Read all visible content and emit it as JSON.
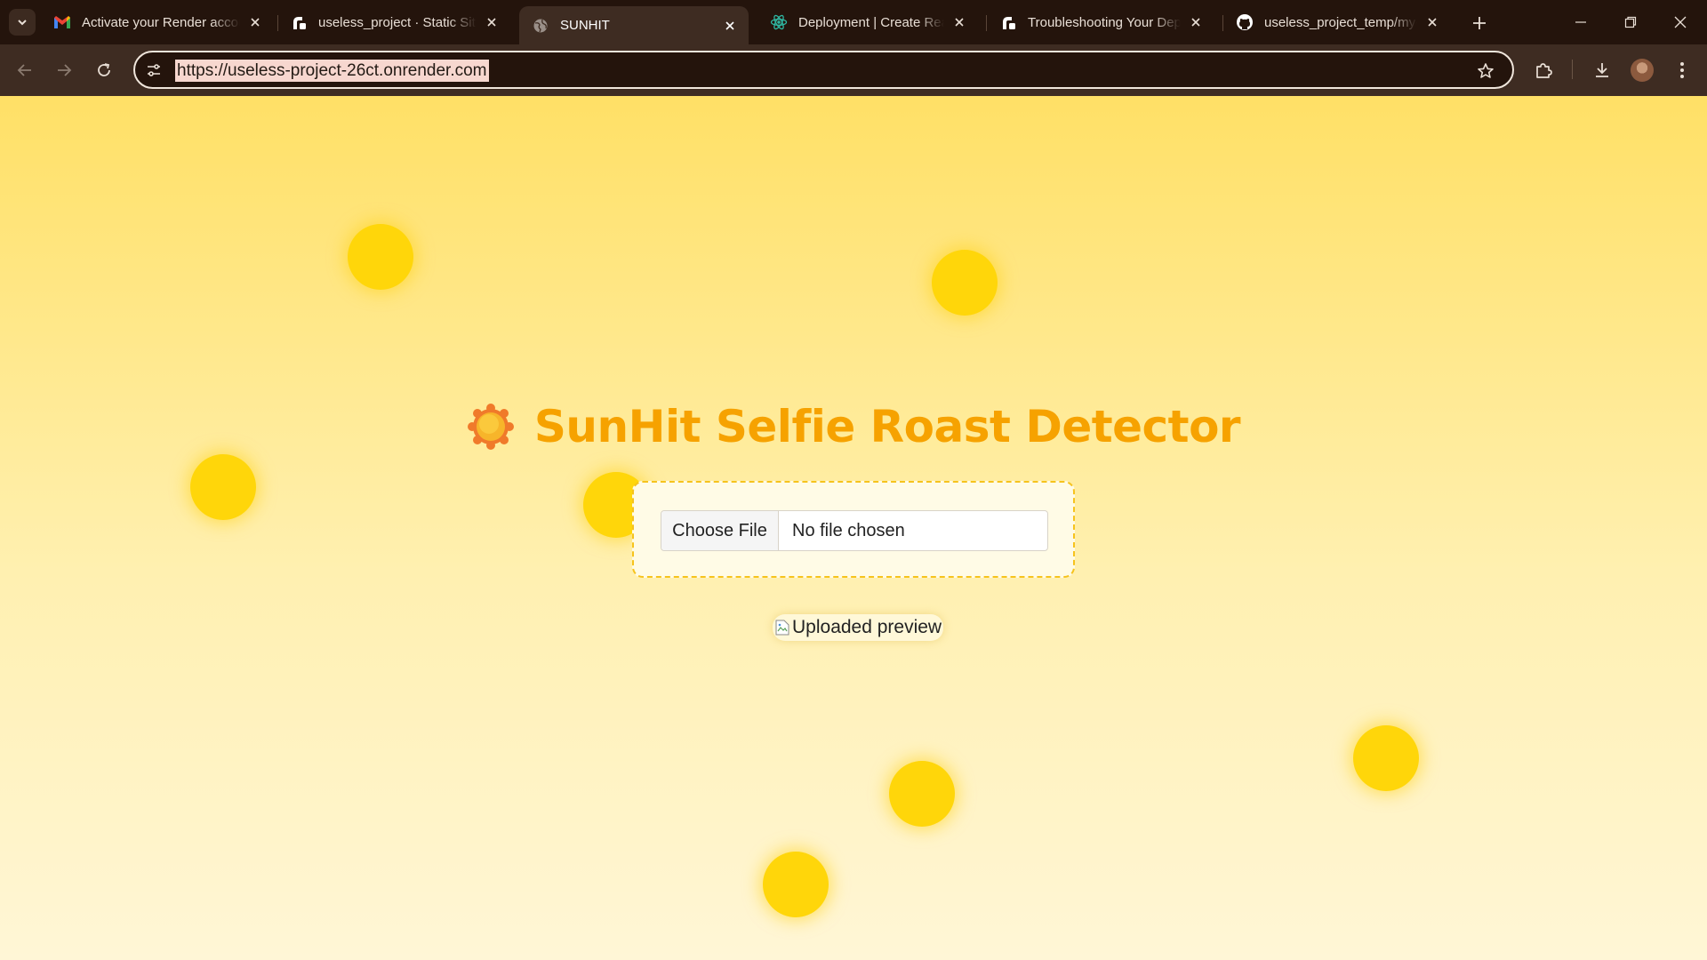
{
  "browser": {
    "tabs": [
      {
        "title": "Activate your Render account",
        "icon": "gmail-icon",
        "active": false
      },
      {
        "title": "useless_project · Static Site",
        "icon": "render-icon",
        "active": false
      },
      {
        "title": "SUNHIT",
        "icon": "globe-icon",
        "active": true
      },
      {
        "title": "Deployment | Create React App",
        "icon": "react-icon",
        "active": false
      },
      {
        "title": "Troubleshooting Your Deploy",
        "icon": "render-icon",
        "active": false
      },
      {
        "title": "useless_project_temp/my-app",
        "icon": "github-icon",
        "active": false
      }
    ],
    "url": "https://useless-project-26ct.onrender.com",
    "colors": {
      "chrome_dark": "#24140c",
      "chrome_toolbar": "#3e2c22",
      "url_highlight": "#f7d7cf"
    }
  },
  "page": {
    "title": "SunHit Selfie Roast Detector",
    "title_icon": "sun-emoji-icon",
    "file_input": {
      "button_label": "Choose File",
      "status": "No file chosen"
    },
    "preview_alt": "Uploaded preview",
    "colors": {
      "title": "#f6a200",
      "sun": "#ffd60a",
      "uploader_border": "#f6c31d",
      "uploader_bg": "#fffbe6"
    }
  }
}
